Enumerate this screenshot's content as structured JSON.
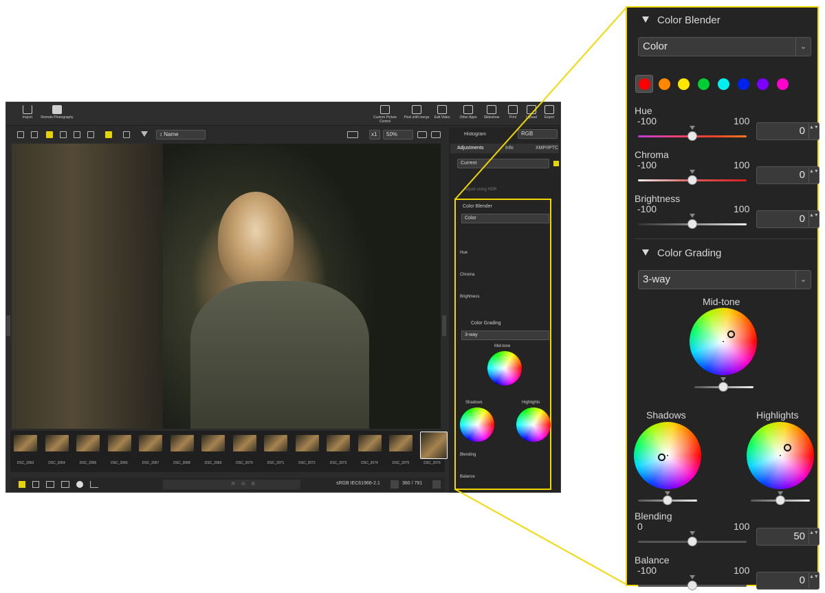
{
  "toolbar": {
    "import": "Import",
    "remote": "Remote Photography",
    "custom_picture": "Custom Picture Control",
    "pixel_shift": "Pixel shift merge",
    "edit_video": "Edit Video",
    "other_apps": "Other Apps",
    "slideshow": "Slideshow",
    "print": "Print",
    "upload": "Upload",
    "export": "Export"
  },
  "subbar": {
    "sort": "Name",
    "zoom": "50%",
    "x1": "x1"
  },
  "filmstrip": [
    "DSC_2063",
    "DSC_2064",
    "DSC_2065",
    "DSC_2066",
    "DSC_2067",
    "DSC_2068",
    "DSC_2069",
    "DSC_2070",
    "DSC_2071",
    "DSC_2072",
    "DSC_2073",
    "DSC_2074",
    "DSC_2075",
    "DSC_2076"
  ],
  "status": {
    "color_space": "sRGB IEC61966-2.1",
    "position": "360 / 791",
    "r": "R:",
    "g": "G:",
    "b": "B:"
  },
  "panel": {
    "histogram": "Histogram",
    "histogram_mode": "RGB",
    "tabs": [
      "Adjustments",
      "Info",
      "XMP/IPTC"
    ],
    "current": "Current",
    "hdr": "Adjust using HDR"
  },
  "zoom": {
    "color_blender": {
      "title": "Color Blender",
      "mode": "Color",
      "swatches": [
        "#ff0000",
        "#ff8800",
        "#ffe600",
        "#00cc33",
        "#00f0f0",
        "#0022ee",
        "#7a00ff",
        "#ff00cc"
      ],
      "hue": {
        "label": "Hue",
        "min": "-100",
        "max": "100",
        "value": "0",
        "level": 0.5
      },
      "chroma": {
        "label": "Chroma",
        "min": "-100",
        "max": "100",
        "value": "0",
        "level": 0.5
      },
      "brightness": {
        "label": "Brightness",
        "min": "-100",
        "max": "100",
        "value": "0",
        "level": 0.5
      }
    },
    "color_grading": {
      "title": "Color Grading",
      "mode": "3-way",
      "midtone": "Mid-tone",
      "shadows": "Shadows",
      "highlights": "Highlights",
      "blending": {
        "label": "Blending",
        "min": "0",
        "max": "100",
        "value": "50",
        "level": 0.5
      },
      "balance": {
        "label": "Balance",
        "min": "-100",
        "max": "100",
        "value": "0",
        "level": 0.5
      }
    }
  }
}
